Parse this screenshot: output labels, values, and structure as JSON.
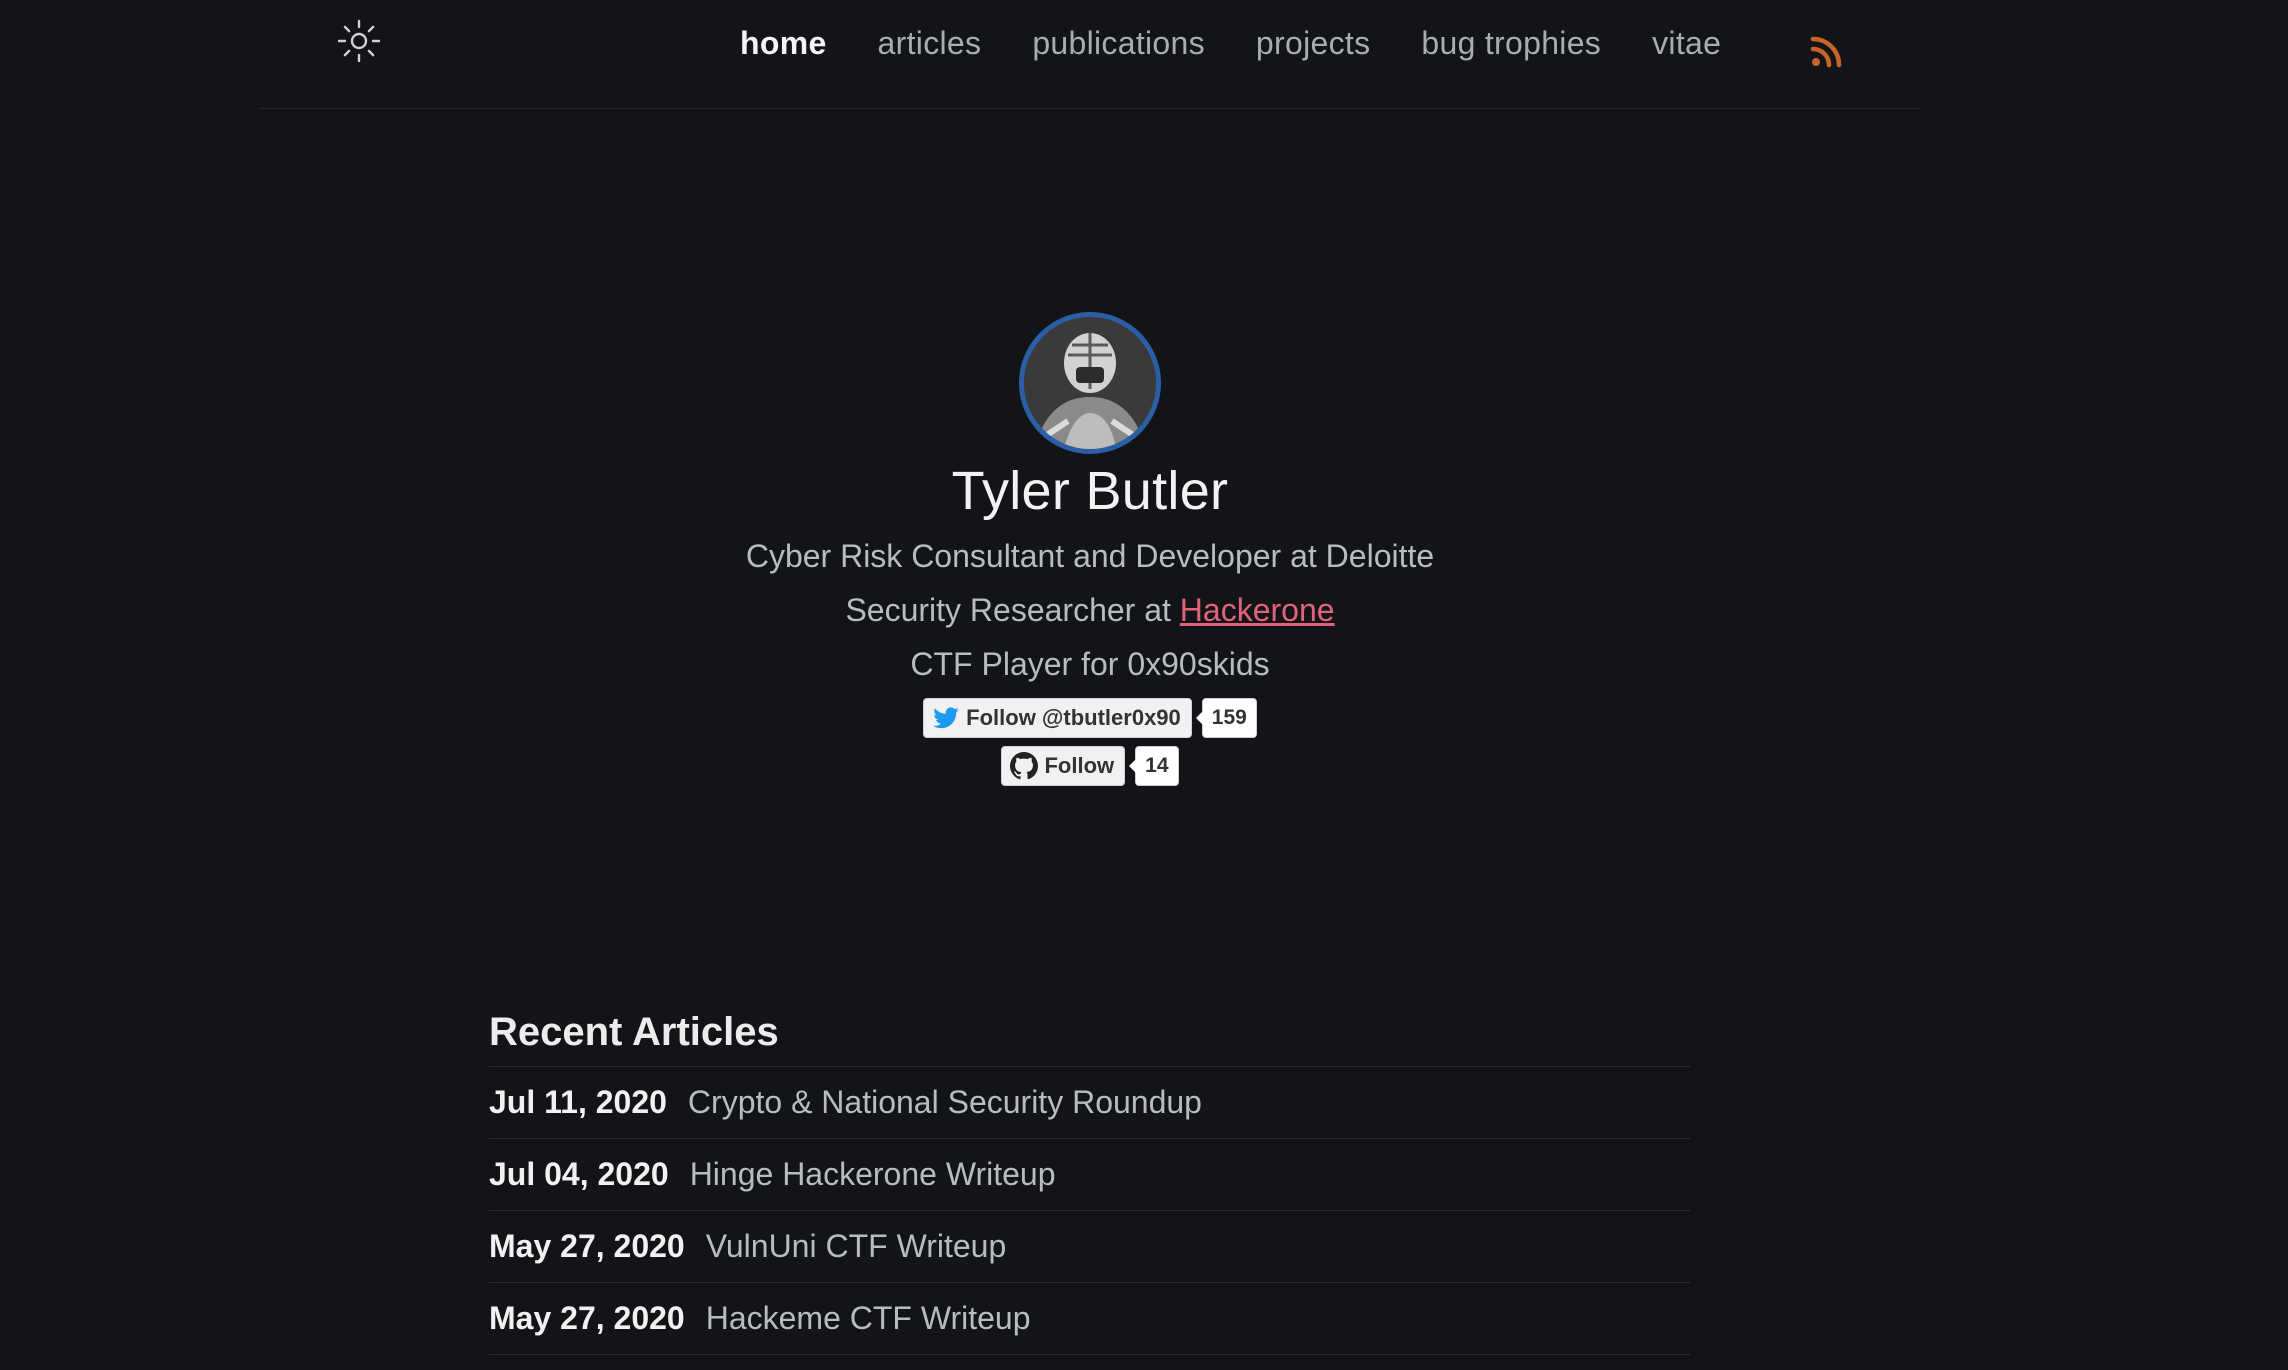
{
  "header": {
    "theme_toggle_icon": "sun-icon",
    "nav": [
      {
        "label": "home",
        "active": true
      },
      {
        "label": "articles",
        "active": false
      },
      {
        "label": "publications",
        "active": false
      },
      {
        "label": "projects",
        "active": false
      },
      {
        "label": "bug trophies",
        "active": false
      },
      {
        "label": "vitae",
        "active": false
      }
    ],
    "rss_icon": "rss-icon"
  },
  "profile": {
    "name": "Tyler Butler",
    "line1": "Cyber Risk Consultant and Developer at Deloitte",
    "line2_prefix": "Security Researcher at ",
    "line2_link": "Hackerone",
    "line3": "CTF Player for 0x90skids",
    "twitter": {
      "label": "Follow @tbutler0x90",
      "count": "159"
    },
    "github": {
      "label": "Follow",
      "count": "14"
    }
  },
  "articles": {
    "heading": "Recent Articles",
    "items": [
      {
        "date": "Jul 11, 2020",
        "title": "Crypto & National Security Roundup"
      },
      {
        "date": "Jul 04, 2020",
        "title": "Hinge Hackerone Writeup"
      },
      {
        "date": "May 27, 2020",
        "title": "VulnUni CTF Writeup"
      },
      {
        "date": "May 27, 2020",
        "title": "Hackeme CTF Writeup"
      }
    ]
  },
  "colors": {
    "background": "#131417",
    "accent_link": "#e0637b",
    "avatar_ring": "#2a5fa8",
    "rss": "#c8642a",
    "twitter_blue": "#1d9bf0"
  }
}
